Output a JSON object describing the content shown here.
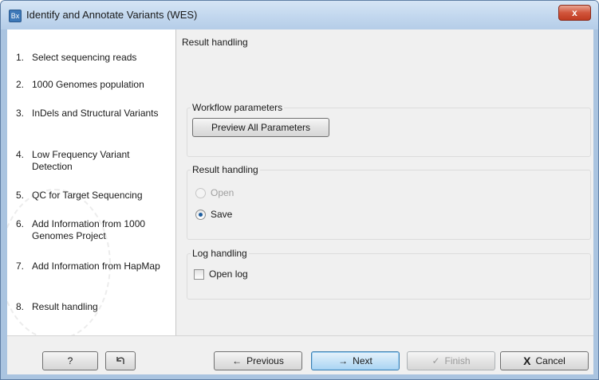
{
  "window": {
    "title": "Identify and Annotate Variants (WES)",
    "app_icon_text": "Bx",
    "close_glyph": "x"
  },
  "steps": [
    {
      "num": "1.",
      "label": "Select sequencing reads"
    },
    {
      "num": "2.",
      "label": "1000 Genomes population"
    },
    {
      "num": "3.",
      "label": "InDels and Structural Variants"
    },
    {
      "num": "4.",
      "label": "Low Frequency Variant Detection"
    },
    {
      "num": "5.",
      "label": "QC for Target Sequencing"
    },
    {
      "num": "6.",
      "label": "Add Information from 1000 Genomes Project"
    },
    {
      "num": "7.",
      "label": "Add Information from HapMap"
    },
    {
      "num": "8.",
      "label": "Result handling"
    }
  ],
  "panel": {
    "title": "Result handling",
    "workflow_group": {
      "label": "Workflow parameters",
      "preview_button": "Preview All Parameters"
    },
    "result_group": {
      "label": "Result handling",
      "open_label": "Open",
      "save_label": "Save",
      "selected": "Save"
    },
    "log_group": {
      "label": "Log handling",
      "open_log_label": "Open log",
      "open_log_checked": false
    }
  },
  "footer": {
    "help_label": "?",
    "reset_icon": "reset-icon",
    "previous_label": "Previous",
    "previous_arrow": "←",
    "next_label": "Next",
    "next_arrow": "→",
    "finish_label": "Finish",
    "finish_check": "✓",
    "cancel_label": "Cancel",
    "cancel_x": "X"
  }
}
